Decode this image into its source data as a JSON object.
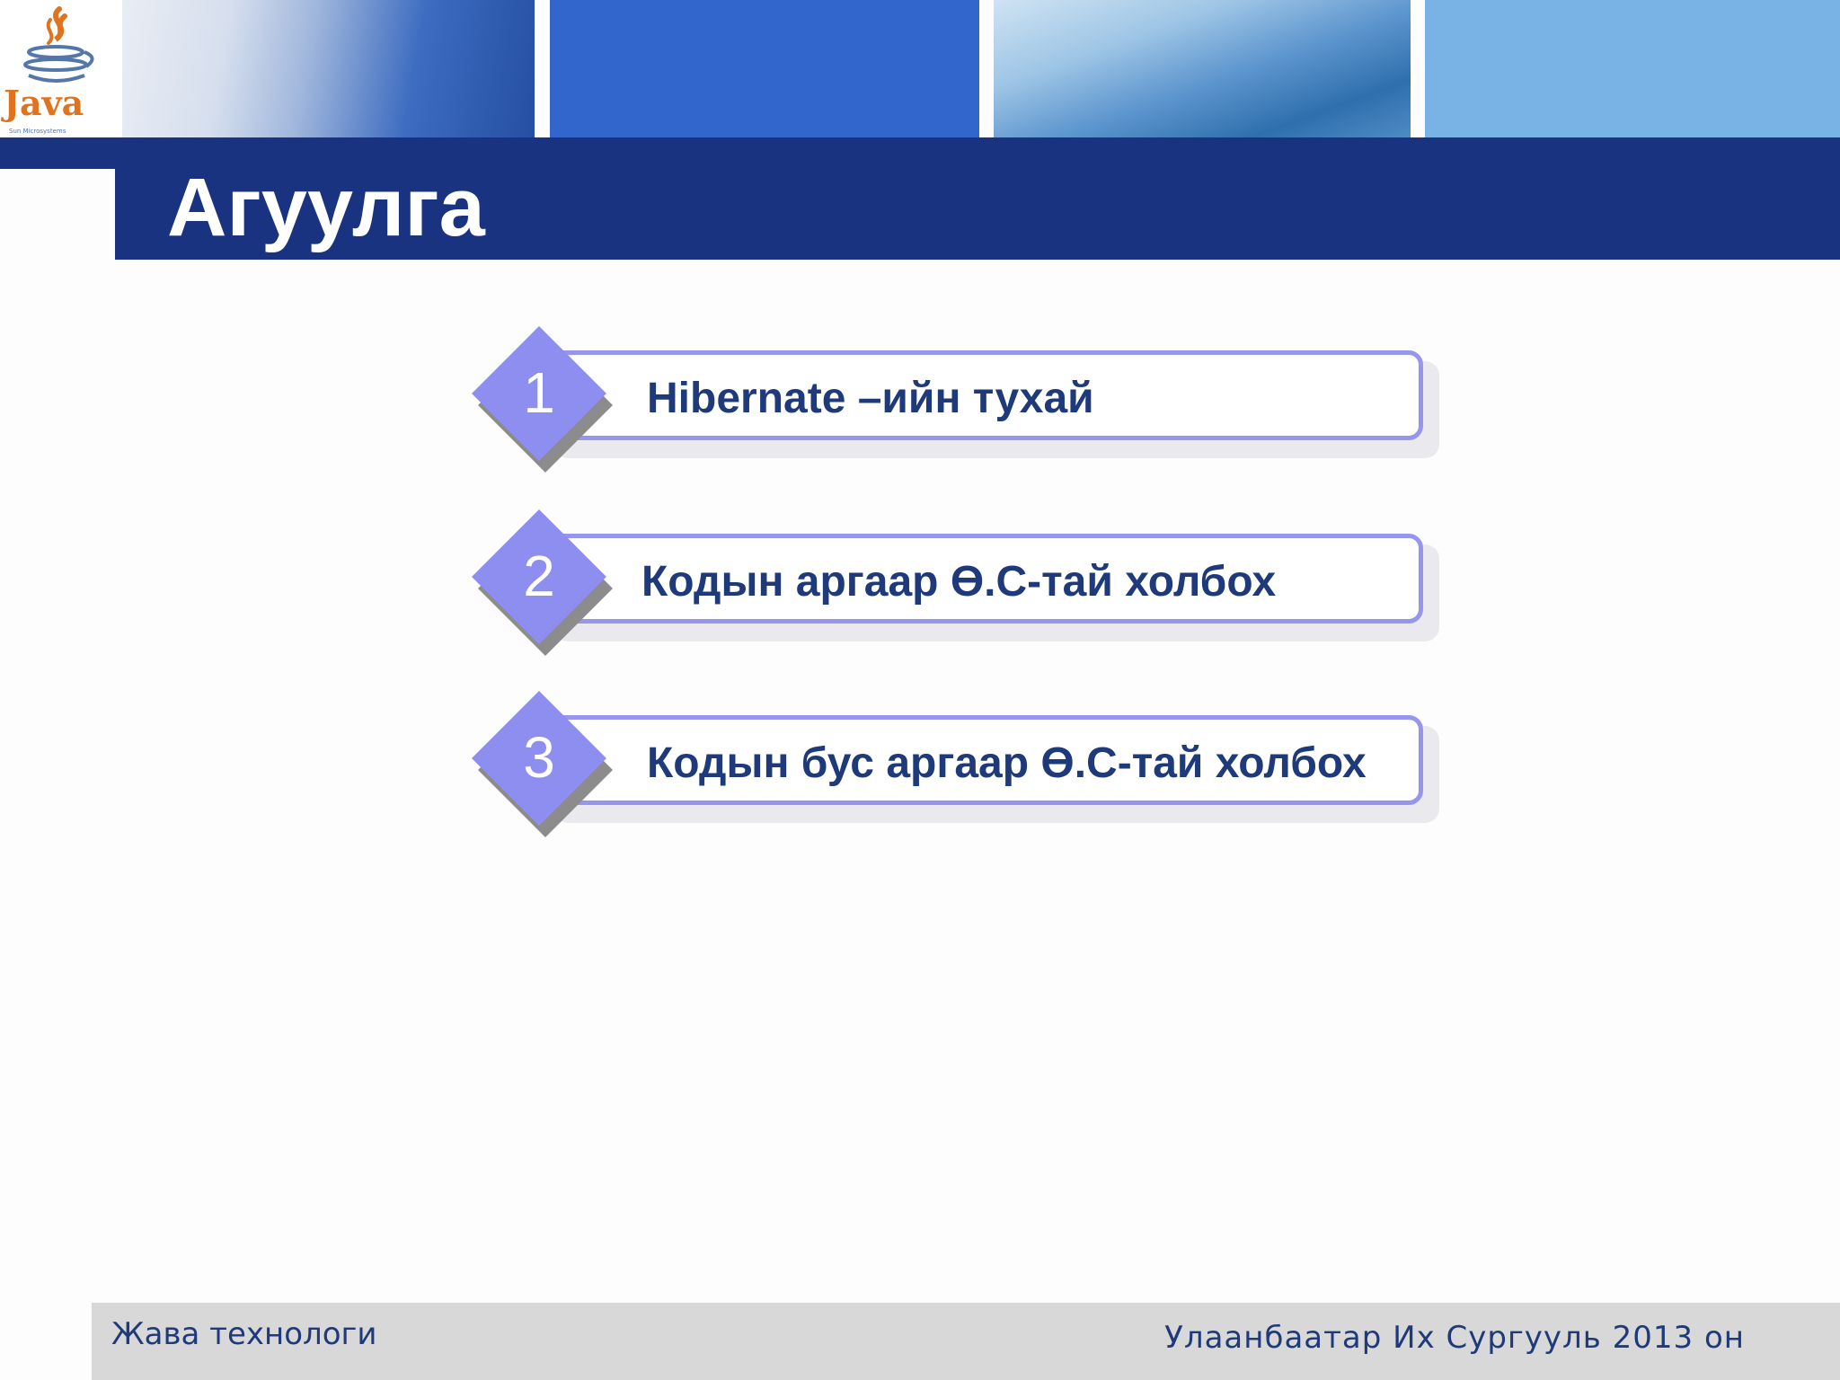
{
  "logo": {
    "name": "java-logo-icon",
    "text": "Java",
    "tagline": "Sun Microsystems"
  },
  "header": {
    "title": "Агуулга"
  },
  "agenda": {
    "items": [
      {
        "number": "1",
        "label": "Hibernate –ийн тухай"
      },
      {
        "number": "2",
        "label": "Кодын аргаар Ө.С-тай холбох"
      },
      {
        "number": "3",
        "label": "Кодын бус аргаар Ө.С-тай холбох"
      }
    ]
  },
  "footer": {
    "left": "Жава технологи",
    "right": "Улаанбаатар Их Сургууль 2013 он"
  },
  "colors": {
    "title_bar": "#1a3380",
    "accent_blue": "#3366cc",
    "diamond": "#8e8ef0",
    "item_border": "#9696ec",
    "item_text": "#1f3a7a",
    "footer_bg": "#d8d8d8"
  }
}
